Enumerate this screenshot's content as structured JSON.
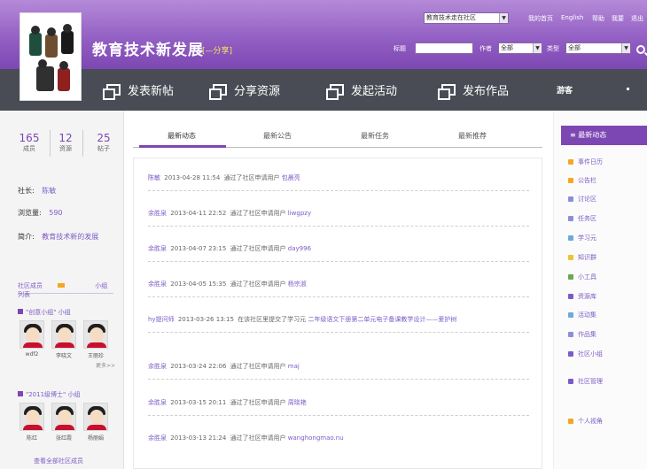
{
  "header": {
    "logo_alt": "school logo",
    "title": "教育技术新发展",
    "subtitle": "[—分享]",
    "community_select": "教育技术走在社区",
    "top_links": [
      "我的首页",
      "English",
      "帮助",
      "我要",
      "退出"
    ],
    "search_label": "标题",
    "author_label": "作者",
    "author_value": "全部",
    "type_label": "类型",
    "type_value": "全部",
    "colors": {
      "header_purple": "#9360c4",
      "nav_dark": "#4a4c55",
      "accent": "#7d47b3",
      "link": "#7b5cc6"
    }
  },
  "nav": {
    "items": [
      "发表新帖",
      "分享资源",
      "发起活动",
      "发布作品"
    ],
    "user": "游客"
  },
  "left": {
    "stats": [
      {
        "num": "165",
        "label": "成员"
      },
      {
        "num": "12",
        "label": "资源"
      },
      {
        "num": "25",
        "label": "帖子"
      }
    ],
    "info": [
      {
        "k": "社长:",
        "v": "陈敏"
      },
      {
        "k": "浏览量:",
        "v": "590"
      },
      {
        "k": "简介:",
        "v": "教育技术新的发展"
      }
    ],
    "small_tabs": [
      "社区成员",
      "小组列表"
    ],
    "groups": [
      {
        "title": "\"创意小组\" 小组",
        "members": [
          "wdf2",
          "李晓文",
          "王丽珍"
        ]
      },
      {
        "title": "\"2011级博士\" 小组",
        "members": [
          "陈红",
          "张红霞",
          "杨丽娟"
        ]
      }
    ],
    "more": "更多>>",
    "footer_link": "查看全部社区成员"
  },
  "center": {
    "tabs": [
      "最新动态",
      "最新公告",
      "最新任务",
      "最新推荐"
    ],
    "feed": [
      {
        "user": "陈敏",
        "time": "2013-04-28 11:54",
        "text": "通过了社区申请用户",
        "target": "包晨亮"
      },
      {
        "user": "余胜泉",
        "time": "2013-04-11 22:52",
        "text": "通过了社区申请用户",
        "target": "liwgpzy"
      },
      {
        "user": "余胜泉",
        "time": "2013-04-07 23:15",
        "text": "通过了社区申请用户",
        "target": "day996"
      },
      {
        "user": "余胜泉",
        "time": "2013-04-05 15:35",
        "text": "通过了社区申请用户",
        "target": "杨宗淑"
      },
      {
        "user": "hy提问师",
        "time": "2013-03-26 13:15",
        "text": "在该社区里提交了学习元",
        "target": "二年级语文下册第二单元电子备课教学设计——爱护树"
      },
      {
        "user": "余胜泉",
        "time": "2013-03-24 22:06",
        "text": "通过了社区申请用户",
        "target": "maj"
      },
      {
        "user": "余胜泉",
        "time": "2013-03-15 20:11",
        "text": "通过了社区申请用户",
        "target": "周晓艳"
      },
      {
        "user": "余胜泉",
        "time": "2013-03-13 21:24",
        "text": "通过了社区申请用户",
        "target": "wanghongmao.nu"
      }
    ]
  },
  "right": {
    "header": "最新动态",
    "items": [
      {
        "label": "事件日历",
        "color": "#f5a623"
      },
      {
        "label": "公告栏",
        "color": "#f5a623"
      },
      {
        "label": "讨论区",
        "color": "#8a8fd8"
      },
      {
        "label": "任务区",
        "color": "#8a8fd8"
      },
      {
        "label": "学习元",
        "color": "#6fa8dc"
      },
      {
        "label": "知识群",
        "color": "#f1c232"
      },
      {
        "label": "小工具",
        "color": "#6aa84f"
      },
      {
        "label": "资源库",
        "color": "#7b5cc6"
      },
      {
        "label": "活动集",
        "color": "#6fa8dc"
      },
      {
        "label": "作品集",
        "color": "#8a8fd8"
      },
      {
        "label": "社区小组",
        "color": "#7b5cc6"
      },
      {
        "label": "社区管理",
        "color": "#7b5cc6"
      },
      {
        "label": "个人视角",
        "color": "#f5a623"
      }
    ]
  }
}
